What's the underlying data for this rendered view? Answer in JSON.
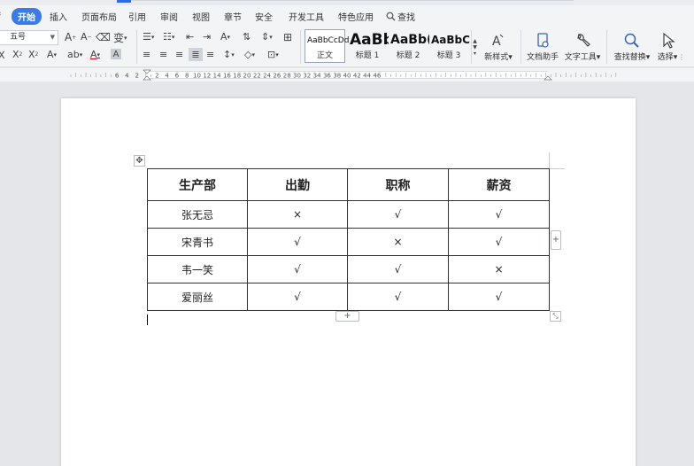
{
  "menu": {
    "tabs": [
      {
        "label": "开始",
        "active": true
      },
      {
        "label": "插入"
      },
      {
        "label": "页面布局"
      },
      {
        "label": "引用"
      },
      {
        "label": "审阅"
      },
      {
        "label": "视图"
      },
      {
        "label": "章节"
      },
      {
        "label": "安全"
      },
      {
        "label": "开发工具"
      },
      {
        "label": "特色应用"
      }
    ],
    "search_label": "查找"
  },
  "ribbon": {
    "font_size": "五号",
    "styles": [
      {
        "sample": "AaBbCcDd",
        "label": "正文",
        "selected": true
      },
      {
        "sample": "AaBb",
        "label": "标题 1"
      },
      {
        "sample": "AaBb(",
        "label": "标题 2"
      },
      {
        "sample": "AaBbC(",
        "label": "标题 3"
      }
    ],
    "new_style_label": "新样式",
    "doc_helper_label": "文档助手",
    "text_tools_label": "文字工具",
    "find_replace_label": "查找替换",
    "select_label": "选择"
  },
  "ruler": {
    "labels": [
      "6",
      "4",
      "2",
      "2",
      "4",
      "6",
      "8",
      "10",
      "12",
      "14",
      "16",
      "18",
      "20",
      "22",
      "24",
      "26",
      "28",
      "30",
      "32",
      "34",
      "36",
      "38",
      "40",
      "42",
      "44",
      "46"
    ]
  },
  "table": {
    "headers": [
      "生产部",
      "出勤",
      "职称",
      "薪资"
    ],
    "rows": [
      [
        "张无忌",
        "×",
        "√",
        "√"
      ],
      [
        "宋青书",
        "√",
        "×",
        "√"
      ],
      [
        "韦一笑",
        "√",
        "√",
        "×"
      ],
      [
        "爱丽丝",
        "√",
        "√",
        "√"
      ]
    ]
  },
  "colors": {
    "accent": "#3a7bea",
    "ribbon_bg": "#f3f4f6",
    "canvas_bg": "#e5e6e9"
  }
}
